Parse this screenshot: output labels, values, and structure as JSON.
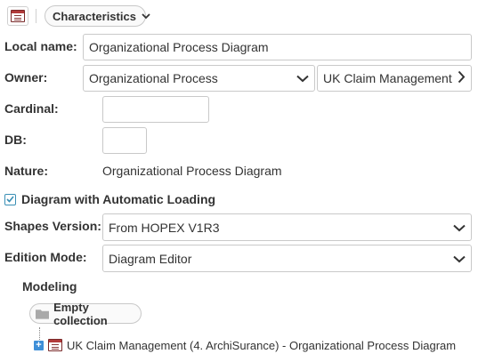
{
  "toolbar": {
    "characteristics_label": "Characteristics"
  },
  "form": {
    "local_name": {
      "label": "Local name:",
      "value": "Organizational Process Diagram"
    },
    "owner": {
      "label": "Owner:",
      "type_value": "Organizational Process",
      "object_value": "UK Claim Management"
    },
    "cardinal": {
      "label": "Cardinal:",
      "value": ""
    },
    "db": {
      "label": "DB:",
      "value": ""
    },
    "nature": {
      "label": "Nature:",
      "value": "Organizational Process Diagram"
    },
    "auto_loading": {
      "label": "Diagram with Automatic Loading",
      "checked": true
    },
    "shapes_version": {
      "label": "Shapes Version:",
      "value": "From HOPEX V1R3"
    },
    "edition_mode": {
      "label": "Edition Mode:",
      "value": "Diagram Editor"
    }
  },
  "modeling": {
    "title": "Modeling",
    "empty_label": "Empty collection",
    "tree_item": "UK Claim Management (4. ArchiSurance) - Organizational Process Diagram"
  }
}
